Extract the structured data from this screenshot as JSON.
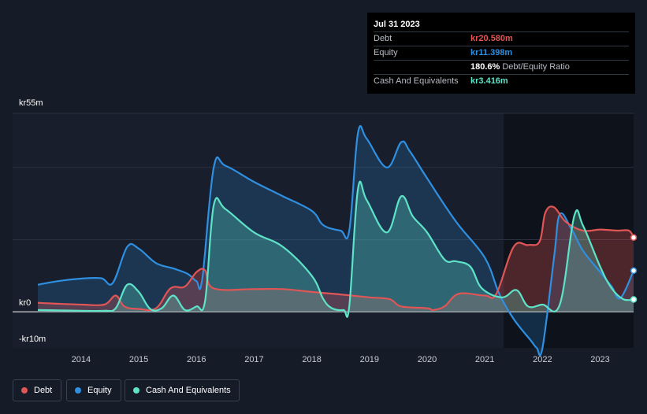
{
  "tooltip": {
    "date": "Jul 31 2023",
    "rows": [
      {
        "label": "Debt",
        "value": "kr20.580m",
        "color": "#e05555"
      },
      {
        "label": "Equity",
        "value": "kr11.398m",
        "color": "#2f8fe0"
      },
      {
        "label": "",
        "value": "180.6%",
        "suffix": "Debt/Equity Ratio",
        "color": "#ffffff"
      },
      {
        "label": "Cash And Equivalents",
        "value": "kr3.416m",
        "color": "#5fe3c8"
      }
    ]
  },
  "chart_data": {
    "type": "area",
    "x_range": [
      2013.25,
      2023.58
    ],
    "ylim": [
      -10,
      55
    ],
    "y_tick_labels": [
      "kr55m",
      "kr0",
      "-kr10m"
    ],
    "x_tick_labels": [
      "2014",
      "2015",
      "2016",
      "2017",
      "2018",
      "2019",
      "2020",
      "2021",
      "2022",
      "2023"
    ],
    "x_ticks": [
      2014,
      2015,
      2016,
      2017,
      2018,
      2019,
      2020,
      2021,
      2022,
      2023
    ],
    "grid": true,
    "legend_position": "bottom-left",
    "series": [
      {
        "name": "Debt",
        "color": "#e05555",
        "points": [
          [
            2013.25,
            2.5
          ],
          [
            2013.5,
            2.3
          ],
          [
            2014.0,
            2.0
          ],
          [
            2014.4,
            2.0
          ],
          [
            2014.6,
            4.5
          ],
          [
            2014.75,
            1.5
          ],
          [
            2015.0,
            0.8
          ],
          [
            2015.3,
            1.0
          ],
          [
            2015.55,
            6.5
          ],
          [
            2015.8,
            7.0
          ],
          [
            2016.0,
            11.0
          ],
          [
            2016.15,
            11.5
          ],
          [
            2016.3,
            6.5
          ],
          [
            2017.0,
            6.3
          ],
          [
            2017.5,
            6.3
          ],
          [
            2018.0,
            5.5
          ],
          [
            2018.5,
            4.8
          ],
          [
            2019.0,
            4.0
          ],
          [
            2019.35,
            3.5
          ],
          [
            2019.55,
            1.5
          ],
          [
            2020.0,
            1.0
          ],
          [
            2020.1,
            0.5
          ],
          [
            2020.3,
            1.5
          ],
          [
            2020.55,
            5.0
          ],
          [
            2021.0,
            4.5
          ],
          [
            2021.2,
            5.0
          ],
          [
            2021.5,
            18.0
          ],
          [
            2021.75,
            18.5
          ],
          [
            2021.95,
            19.5
          ],
          [
            2022.05,
            27.5
          ],
          [
            2022.2,
            29.0
          ],
          [
            2022.4,
            25.0
          ],
          [
            2022.7,
            22.5
          ],
          [
            2023.0,
            22.8
          ],
          [
            2023.3,
            22.5
          ],
          [
            2023.5,
            22.5
          ],
          [
            2023.58,
            20.58
          ]
        ]
      },
      {
        "name": "Equity",
        "color": "#2f8fe0",
        "points": [
          [
            2013.25,
            7.5
          ],
          [
            2013.6,
            8.5
          ],
          [
            2014.0,
            9.2
          ],
          [
            2014.35,
            9.3
          ],
          [
            2014.55,
            8.0
          ],
          [
            2014.8,
            18.0
          ],
          [
            2015.0,
            17.5
          ],
          [
            2015.3,
            13.5
          ],
          [
            2015.6,
            12.0
          ],
          [
            2015.85,
            10.5
          ],
          [
            2016.0,
            8.5
          ],
          [
            2016.1,
            9.0
          ],
          [
            2016.3,
            40.0
          ],
          [
            2016.5,
            40.5
          ],
          [
            2017.0,
            36.0
          ],
          [
            2017.5,
            32.0
          ],
          [
            2018.0,
            28.0
          ],
          [
            2018.2,
            24.0
          ],
          [
            2018.5,
            22.5
          ],
          [
            2018.65,
            22.5
          ],
          [
            2018.8,
            49.5
          ],
          [
            2018.95,
            48.0
          ],
          [
            2019.3,
            40.0
          ],
          [
            2019.55,
            47.0
          ],
          [
            2019.7,
            44.5
          ],
          [
            2020.0,
            37.0
          ],
          [
            2020.5,
            25.0
          ],
          [
            2021.0,
            15.0
          ],
          [
            2021.25,
            5.0
          ],
          [
            2021.5,
            -2.0
          ],
          [
            2021.8,
            -8.0
          ],
          [
            2021.9,
            -10.0
          ],
          [
            2022.0,
            -10.0
          ],
          [
            2022.2,
            15.0
          ],
          [
            2022.3,
            27.0
          ],
          [
            2022.5,
            23.0
          ],
          [
            2022.7,
            17.0
          ],
          [
            2023.0,
            11.0
          ],
          [
            2023.2,
            7.0
          ],
          [
            2023.35,
            3.8
          ],
          [
            2023.58,
            11.398
          ]
        ]
      },
      {
        "name": "Cash And Equivalents",
        "color": "#5fe3c8",
        "points": [
          [
            2013.25,
            0.5
          ],
          [
            2013.6,
            0.4
          ],
          [
            2014.0,
            0.3
          ],
          [
            2014.4,
            0.3
          ],
          [
            2014.6,
            1.0
          ],
          [
            2014.8,
            7.5
          ],
          [
            2015.0,
            5.5
          ],
          [
            2015.2,
            0.8
          ],
          [
            2015.4,
            1.0
          ],
          [
            2015.6,
            4.5
          ],
          [
            2015.8,
            0.5
          ],
          [
            2016.0,
            1.5
          ],
          [
            2016.15,
            3.0
          ],
          [
            2016.3,
            29.5
          ],
          [
            2016.5,
            28.5
          ],
          [
            2017.0,
            22.0
          ],
          [
            2017.5,
            18.0
          ],
          [
            2018.0,
            10.0
          ],
          [
            2018.2,
            3.5
          ],
          [
            2018.35,
            1.0
          ],
          [
            2018.55,
            0.5
          ],
          [
            2018.65,
            1.5
          ],
          [
            2018.8,
            34.0
          ],
          [
            2018.95,
            31.0
          ],
          [
            2019.3,
            22.0
          ],
          [
            2019.55,
            32.0
          ],
          [
            2019.75,
            26.5
          ],
          [
            2020.0,
            22.0
          ],
          [
            2020.3,
            14.5
          ],
          [
            2020.5,
            14.0
          ],
          [
            2020.75,
            12.5
          ],
          [
            2020.95,
            6.5
          ],
          [
            2021.3,
            4.0
          ],
          [
            2021.55,
            6.0
          ],
          [
            2021.75,
            1.5
          ],
          [
            2022.0,
            2.0
          ],
          [
            2022.3,
            2.0
          ],
          [
            2022.55,
            26.5
          ],
          [
            2022.7,
            24.0
          ],
          [
            2023.0,
            12.5
          ],
          [
            2023.2,
            6.5
          ],
          [
            2023.4,
            3.5
          ],
          [
            2023.58,
            3.416
          ]
        ]
      }
    ]
  },
  "legend": [
    {
      "label": "Debt",
      "color": "#e05555"
    },
    {
      "label": "Equity",
      "color": "#2f8fe0"
    },
    {
      "label": "Cash And Equivalents",
      "color": "#5fe3c8"
    }
  ]
}
